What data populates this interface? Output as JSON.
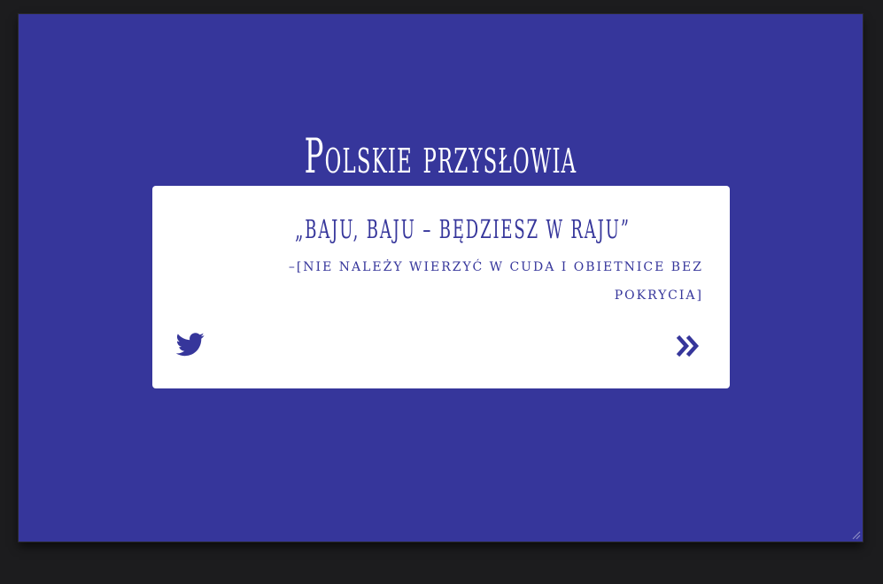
{
  "app": {
    "title": "Polskie przysłowia"
  },
  "quote_card": {
    "quote": "„Baju, baju – będziesz w raju”",
    "author": "–[Nie należy wierzyć w cuda i obietnice bez pokrycia]",
    "tweet_icon": "twitter-icon",
    "next_icon": "double-chevron-right-icon"
  },
  "colors": {
    "background": "#36369b",
    "card": "#ffffff",
    "accent": "#36369b",
    "frame": "#1c1c1e"
  }
}
